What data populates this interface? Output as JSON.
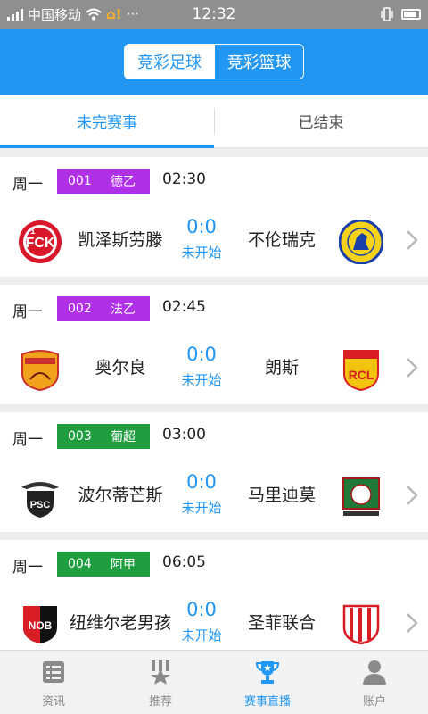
{
  "statusbar": {
    "carrier": "中国移动",
    "time": "12:32",
    "warning_icon": "warning-icon",
    "more": "···"
  },
  "header": {
    "segment": [
      {
        "label": "竞彩足球",
        "active": true
      },
      {
        "label": "竞彩篮球",
        "active": false
      }
    ]
  },
  "tabs": [
    {
      "label": "未完赛事",
      "active": true
    },
    {
      "label": "已结束",
      "active": false
    }
  ],
  "matches": [
    {
      "day": "周一",
      "number": "001",
      "league": "德乙",
      "badge_color": "#b030e8",
      "time": "02:30",
      "home": "凯泽斯劳滕",
      "home_lines": [
        "凯泽斯劳",
        "滕"
      ],
      "score": "0:0",
      "status": "未开始",
      "away": "不伦瑞克",
      "home_logo": "kaiserslautern-logo",
      "away_logo": "braunschweig-logo"
    },
    {
      "day": "周一",
      "number": "002",
      "league": "法乙",
      "badge_color": "#b030e8",
      "time": "02:45",
      "home": "奥尔良",
      "home_lines": [
        "奥尔良"
      ],
      "score": "0:0",
      "status": "未开始",
      "away": "朗斯",
      "home_logo": "orleans-logo",
      "away_logo": "lens-logo"
    },
    {
      "day": "周一",
      "number": "003",
      "league": "葡超",
      "badge_color": "#1e9e3e",
      "time": "03:00",
      "home": "波尔蒂芒斯",
      "home_lines": [
        "波尔蒂芒",
        "斯"
      ],
      "score": "0:0",
      "status": "未开始",
      "away": "马里迪莫",
      "home_logo": "portimonense-logo",
      "away_logo": "maritimo-logo"
    },
    {
      "day": "周一",
      "number": "004",
      "league": "阿甲",
      "badge_color": "#1e9e3e",
      "time": "06:05",
      "home": "纽维尔老男孩",
      "home_lines": [
        "纽维尔老",
        "男孩"
      ],
      "score": "0:0",
      "status": "未开始",
      "away": "圣菲联合",
      "home_logo": "newells-logo",
      "away_logo": "union-santa-fe-logo"
    }
  ],
  "bottomnav": [
    {
      "label": "资讯",
      "icon": "news-icon",
      "active": false
    },
    {
      "label": "推荐",
      "icon": "recommend-icon",
      "active": false
    },
    {
      "label": "赛事直播",
      "icon": "trophy-icon",
      "active": true
    },
    {
      "label": "账户",
      "icon": "account-icon",
      "active": false
    }
  ],
  "colors": {
    "primary": "#2196f3",
    "badge_purple": "#b030e8",
    "badge_green": "#1e9e3e",
    "list_bg": "#eeeeee"
  }
}
